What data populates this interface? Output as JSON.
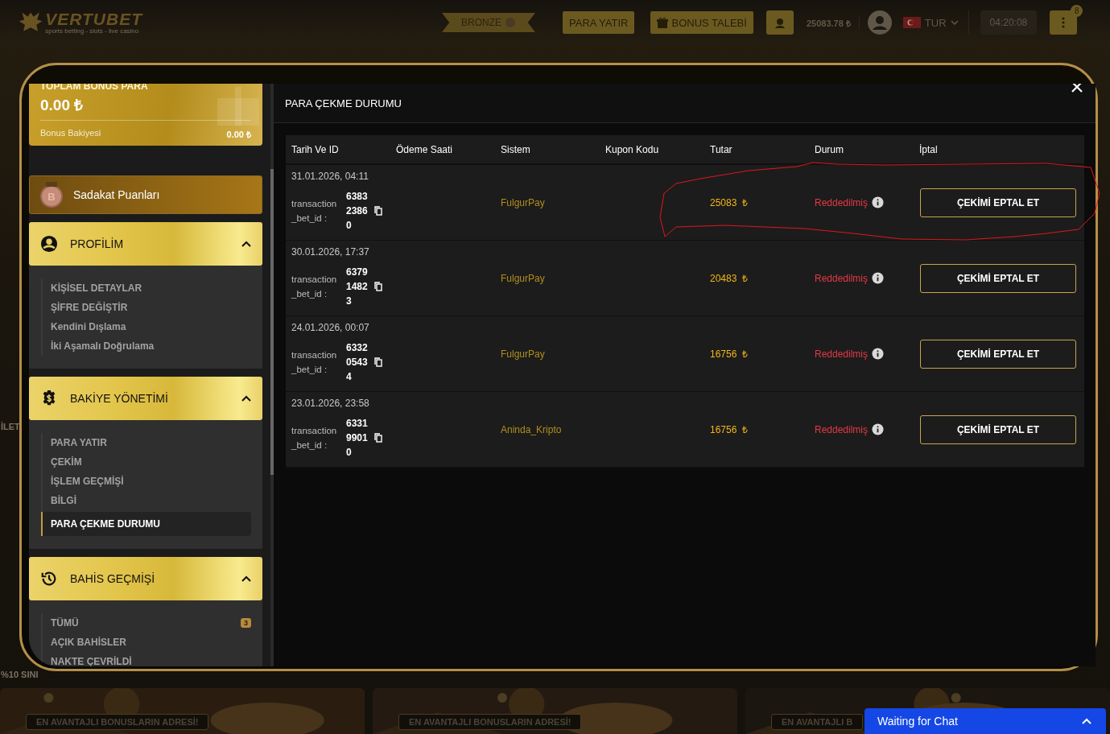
{
  "header": {
    "logo": "VERTUBET",
    "tagline": "sports betting - slots - live casino",
    "rank": "BRONZE",
    "buttons": [
      "PARA YATIR",
      "BONUS TALEBİ"
    ],
    "balance": "25083.78 ₺",
    "language": "TUR",
    "clock": "04:20:08",
    "notification_count": "8"
  },
  "background": {
    "side_texts": [
      "İLET",
      "%10 SINI"
    ],
    "banners": [
      {
        "label": "EN AVANTAJLI BONUSLARIN ADRESİ!",
        "kind": "picture"
      },
      {
        "label": "EN AVANTAJLI BONUSLARIN ADRESİ!",
        "kind": "picture"
      },
      {
        "label": "EN AVANTAJLI B",
        "kind": "picture"
      }
    ]
  },
  "modal": {
    "sidebar": {
      "bonus_card": {
        "title": "TOPLAM BONUS PARA",
        "amount": "0.00 ₺",
        "label": "Bonus Bakiyesi",
        "value": "0.00 ₺"
      },
      "loyalty": {
        "badge_letter": "B",
        "label": "Sadakat Puanları"
      },
      "groups": [
        {
          "title": "PROFİLİM",
          "expanded": true,
          "items": [
            {
              "label": "KİŞİSEL DETAYLAR",
              "selected": false
            },
            {
              "label": "ŞİFRE DEĞİŞTİR",
              "selected": false
            },
            {
              "label": "Kendini Dışlama",
              "selected": false
            },
            {
              "label": "İki Aşamalı Doğrulama",
              "selected": false
            }
          ]
        },
        {
          "title": "BAKİYE YÖNETİMİ",
          "expanded": true,
          "items": [
            {
              "label": "PARA YATIR",
              "selected": false
            },
            {
              "label": "ÇEKİM",
              "selected": false
            },
            {
              "label": "İŞLEM GEÇMİŞİ",
              "selected": false
            },
            {
              "label": "BİLGİ",
              "selected": false
            },
            {
              "label": "PARA ÇEKME DURUMU",
              "selected": true
            }
          ]
        },
        {
          "title": "BAHİS GEÇMİŞİ",
          "expanded": true,
          "items": [
            {
              "label": "TÜMÜ",
              "selected": false,
              "badge": "3"
            },
            {
              "label": "AÇIK BAHİSLER",
              "selected": false
            },
            {
              "label": "NAKTE ÇEVRİLDİ",
              "selected": false
            }
          ]
        }
      ]
    },
    "title": "PARA ÇEKME DURUMU",
    "table": {
      "columns": [
        "Tarih Ve ID",
        "Ödeme Saati",
        "Sistem",
        "Kupon Kodu",
        "Tutar",
        "Durum",
        "İptal"
      ],
      "rows": [
        {
          "date": "31.01.2026, 04:11",
          "id_label": "transaction _bet_id :",
          "id": "638323860",
          "system": "FulgurPay",
          "amount": "25083",
          "currency": "₺",
          "status": "Reddedilmiş",
          "action": "ÇEKİMİ EPTAL ET"
        },
        {
          "date": "30.01.2026, 17:37",
          "id_label": "transaction _bet_id :",
          "id": "637914823",
          "system": "FulgurPay",
          "amount": "20483",
          "currency": "₺",
          "status": "Reddedilmiş",
          "action": "ÇEKİMİ EPTAL ET"
        },
        {
          "date": "24.01.2026, 00:07",
          "id_label": "transaction _bet_id :",
          "id": "633205434",
          "system": "FulgurPay",
          "amount": "16756",
          "currency": "₺",
          "status": "Reddedilmiş",
          "action": "ÇEKİMİ EPTAL ET"
        },
        {
          "date": "23.01.2026, 23:58",
          "id_label": "transaction _bet_id :",
          "id": "633199010",
          "system": "Aninda_Kripto",
          "amount": "16756",
          "currency": "₺",
          "status": "Reddedilmiş",
          "action": "ÇEKİMİ EPTAL ET"
        }
      ]
    }
  },
  "chat": {
    "label": "Waiting for Chat"
  }
}
